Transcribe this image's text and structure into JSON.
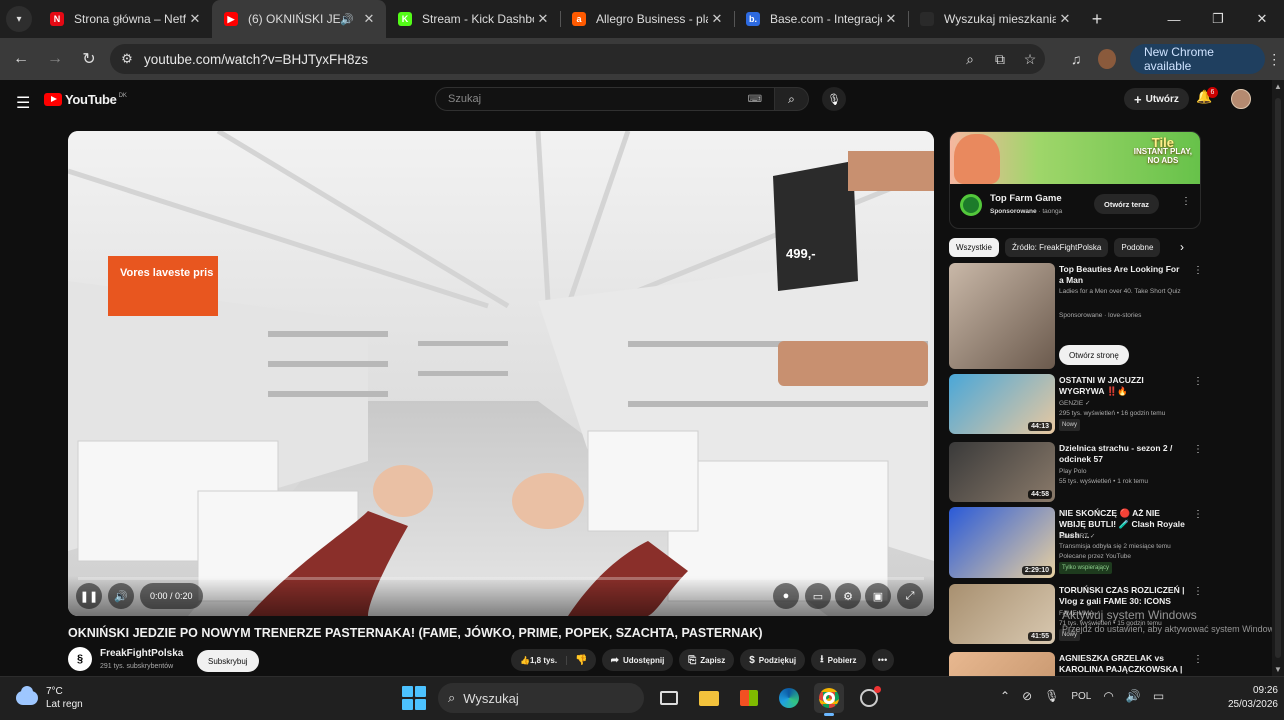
{
  "browser": {
    "tabs": [
      {
        "title": "Strona główna – Netfl",
        "icon_color": "#e50914",
        "icon_glyph": "N"
      },
      {
        "title": "(6) OKNIŃSKI JEDZ",
        "icon_color": "#ff0000",
        "icon_glyph": "▶",
        "active": true,
        "audio_icon": "speaker-icon"
      },
      {
        "title": "Stream - Kick Dashbo",
        "icon_color": "#53fc18",
        "icon_glyph": "K"
      },
      {
        "title": "Allegro Business - pla",
        "icon_color": "#ff5a00",
        "icon_glyph": "a"
      },
      {
        "title": "Base.com - Integracje",
        "icon_color": "#2d6ae0",
        "icon_glyph": "b."
      },
      {
        "title": "Wyszukaj mieszkania",
        "icon_color": "#2a2a2a",
        "icon_glyph": ""
      }
    ],
    "new_tab_label": "+",
    "url": "youtube.com/watch?v=BHJTyxFH8zs",
    "update_button": "New Chrome available"
  },
  "youtube": {
    "logo_text": "YouTube",
    "logo_country": "DK",
    "search_placeholder": "Szukaj",
    "create_label": "Utwórz",
    "notifications_count": "6",
    "video": {
      "title": "OKNIŃSKI JEDZIE PO NOWYM TRENERZE PASTERNAKA! (FAME, JÓWKO, PRIME, POPEK, SZACHTA, PASTERNAK)",
      "time": "0:00 / 0:20",
      "progress": 0,
      "store_sign": "Vores laveste pris",
      "price_sign": "499,-"
    },
    "channel": {
      "name": "FreakFightPolska",
      "subscribers": "291 tys. subskrybentów",
      "subscribe_label": "Subskrybuj",
      "avatar_letter": "§"
    },
    "actions": {
      "likes": "1,8 tys.",
      "share": "Udostępnij",
      "save": "Zapisz",
      "thanks": "Podziękuj",
      "download": "Pobierz"
    },
    "ad": {
      "banner_line1": "Tile",
      "banner_line2": "INSTANT PLAY,",
      "banner_line3": "NO ADS",
      "title": "Top Farm Game",
      "sponsored": "Sponsorowane",
      "advertiser": "taonga",
      "cta": "Otwórz teraz"
    },
    "chips": [
      "Wszystkie",
      "Źródło: FreakFightPolska",
      "Podobne"
    ],
    "recommendations": [
      {
        "title": "Top Beauties Are Looking For a Man",
        "line1": "Ladies for a Men over 40. Take Short Quiz",
        "line2": "Sponsorowane · love-stories",
        "cta": "Otwórz stronę",
        "duration": ""
      },
      {
        "title": "OSTATNI W JACUZZI WYGRYWA ‼️🔥",
        "line1": "GENZIE ✓",
        "line2": "295 tys. wyświetleń • 16 godzin temu",
        "badge": "Nowy",
        "duration": "44:13"
      },
      {
        "title": "Dzielnica strachu - sezon 2 / odcinek 57",
        "line1": "Play Polo",
        "line2": "55 tys. wyświetleń • 1 rok temu",
        "duration": "44:58"
      },
      {
        "title": "NIE SKOŃCZĘ 🔴 AŻ NIE WBIJĘ BUTLI! 🧪 Clash Royale Push ...",
        "line1": "Taksi ZRT ✓",
        "line2": "Transmisja odbyła się 2 miesiące temu",
        "line3": "Polecane przez YouTube",
        "badge_green": "Tylko wspierający",
        "duration": "2:29:10"
      },
      {
        "title": "TORUŃSKI CZAS ROZLICZEŃ | Vlog z gali FAME 30: ICONS",
        "line1": "FAME MMA ✓",
        "line2": "71 tys. wyświetleń • 15 godzin temu",
        "badge": "Nowy",
        "duration": "41:55"
      },
      {
        "title": "AGNIESZKA GRZELAK vs KAROLINA PAJĄCZKOWSKA | ...",
        "line1": "",
        "line2": "",
        "duration": ""
      }
    ],
    "windows_watermark_1": "Aktywuj system Windows",
    "windows_watermark_2": "Przejdź do ustawień, aby aktywować system Windows."
  },
  "taskbar": {
    "temperature": "7°C",
    "weather": "Lat regn",
    "search": "Wyszukaj",
    "language": "POL",
    "time": "09:26",
    "date": "25/03/2026"
  }
}
